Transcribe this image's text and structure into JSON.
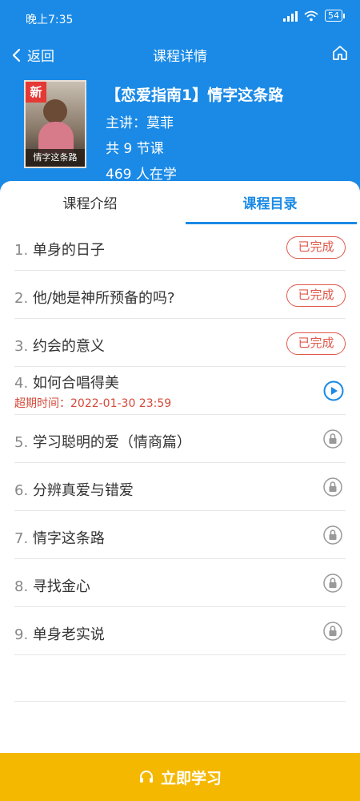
{
  "status_bar": {
    "time": "晚上7:35",
    "battery": "54"
  },
  "nav": {
    "back_label": "返回",
    "title": "课程详情"
  },
  "course": {
    "cover_badge": "新",
    "cover_title": "情字这条路",
    "title": "【恋爱指南1】情字这条路",
    "lecturer": "主讲：莫菲",
    "lessons_count": "共 9 节课",
    "learners": "469 人在学"
  },
  "tabs": [
    {
      "label": "课程介绍",
      "active": false
    },
    {
      "label": "课程目录",
      "active": true
    }
  ],
  "lessons": [
    {
      "num": "1.",
      "title": "单身的日子",
      "status": "已完成"
    },
    {
      "num": "2.",
      "title": "他/她是神所预备的吗?",
      "status": "已完成"
    },
    {
      "num": "3.",
      "title": "约会的意义",
      "status": "已完成"
    },
    {
      "num": "4.",
      "title": "如何合唱得美",
      "status": "playing",
      "expire": "超期时间：2022-01-30 23:59"
    },
    {
      "num": "5.",
      "title": "学习聪明的爱（情商篇）",
      "status": "locked"
    },
    {
      "num": "6.",
      "title": "分辨真爱与错爱",
      "status": "locked"
    },
    {
      "num": "7.",
      "title": "情字这条路",
      "status": "locked"
    },
    {
      "num": "8.",
      "title": "寻找金心",
      "status": "locked"
    },
    {
      "num": "9.",
      "title": "单身老实说",
      "status": "locked"
    }
  ],
  "cta": {
    "label": "立即学习"
  },
  "colors": {
    "primary": "#1a8ae6",
    "done": "#e0584a",
    "cta": "#f5b800",
    "expire": "#d44a3a"
  }
}
